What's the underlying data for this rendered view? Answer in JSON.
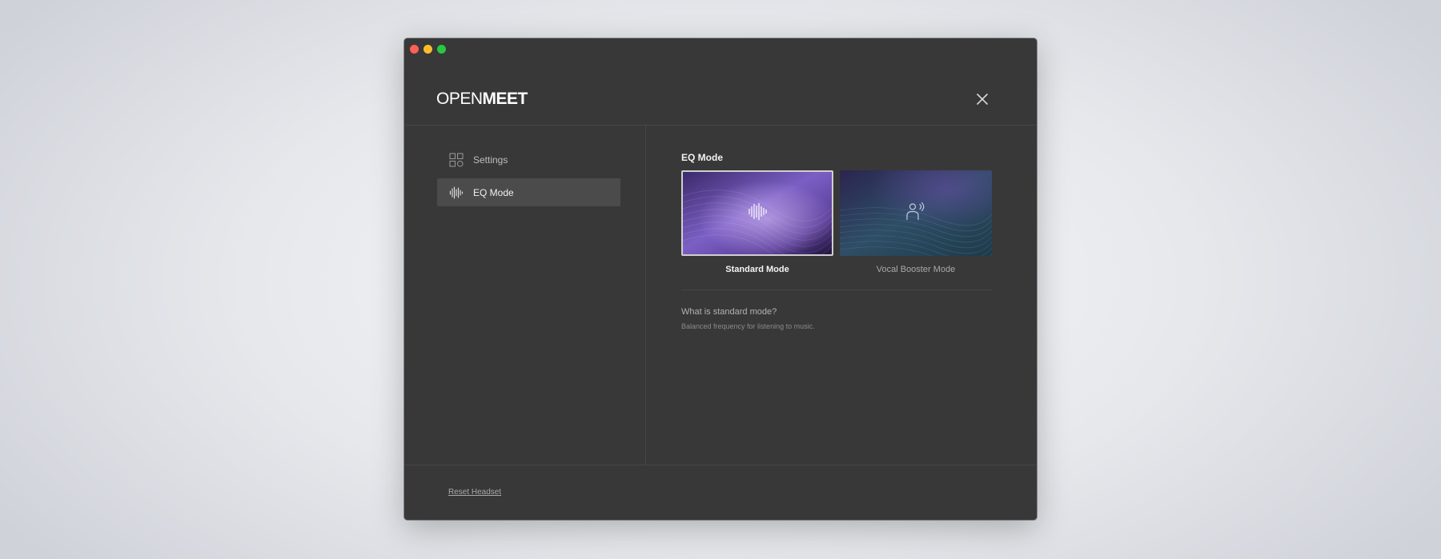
{
  "app": {
    "logo_light": "OPEN",
    "logo_bold": "MEET"
  },
  "sidebar": {
    "items": [
      {
        "label": "Settings",
        "icon": "settings-grid-icon",
        "active": false
      },
      {
        "label": "EQ Mode",
        "icon": "waveform-icon",
        "active": true
      }
    ]
  },
  "eq": {
    "title": "EQ Mode",
    "modes": [
      {
        "label": "Standard Mode",
        "icon": "waveform-icon",
        "selected": true
      },
      {
        "label": "Vocal Booster Mode",
        "icon": "person-voice-icon",
        "selected": false
      }
    ],
    "info_question": "What is standard mode?",
    "info_answer": "Balanced frequency for listening to music."
  },
  "footer": {
    "reset_label": "Reset Headset"
  },
  "colors": {
    "window_bg": "#383838",
    "active_nav_bg": "#4b4b4b",
    "selected_border": "#cfcfcf",
    "standard_thumb": "#8a6fd0",
    "vocal_thumb": "#2f5a6e"
  }
}
